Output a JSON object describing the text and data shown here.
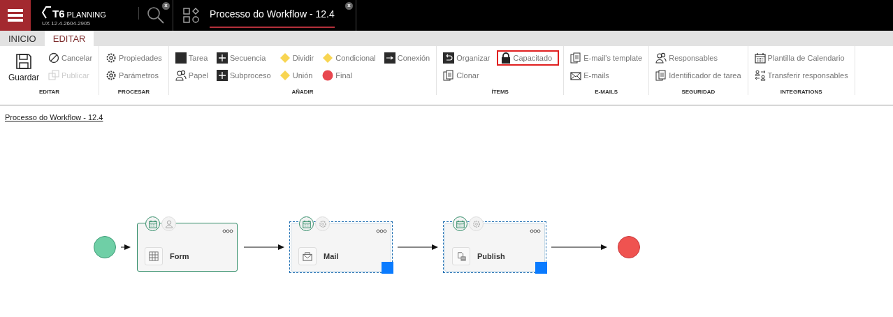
{
  "header": {
    "logo": {
      "mark": "T6",
      "name": "PLANNING",
      "version": "UX 12.4.2604.2905"
    },
    "search_tab": {
      "close": "x"
    },
    "document_tab": {
      "title": "Processo do Workflow - 12.4",
      "close": "x",
      "selected": true
    }
  },
  "tabs": [
    {
      "label": "INICIO",
      "selected": false
    },
    {
      "label": "EDITAR",
      "selected": true
    }
  ],
  "ribbon": [
    {
      "label": "EDITAR",
      "large": {
        "label": "Guardar",
        "kind": "save"
      },
      "rows": [
        [
          {
            "label": "Cancelar",
            "kind": "cancel",
            "disabled": false,
            "highlighted": false
          }
        ],
        [
          {
            "label": "Publicar",
            "kind": "publish",
            "disabled": true,
            "highlighted": false
          }
        ]
      ]
    },
    {
      "label": "PROCESAR",
      "rows": [
        [
          {
            "label": "Propiedades",
            "kind": "gear",
            "disabled": false,
            "highlighted": false
          }
        ],
        [
          {
            "label": "Parámetros",
            "kind": "gear",
            "disabled": false,
            "highlighted": false
          }
        ]
      ]
    },
    {
      "label": "AÑADIR",
      "rows": [
        [
          {
            "label": "Tarea",
            "kind": "square",
            "disabled": false,
            "highlighted": false
          },
          {
            "label": "Secuencia",
            "kind": "plus",
            "disabled": false,
            "highlighted": false
          },
          {
            "label": "Dividir",
            "kind": "diamond",
            "disabled": false,
            "highlighted": false
          },
          {
            "label": "Condicional",
            "kind": "diamond",
            "disabled": false,
            "highlighted": false
          },
          {
            "label": "Conexión",
            "kind": "connector",
            "disabled": false,
            "highlighted": false
          }
        ],
        [
          {
            "label": "Papel",
            "kind": "people",
            "disabled": false,
            "highlighted": false
          },
          {
            "label": "Subproceso",
            "kind": "plus",
            "disabled": false,
            "highlighted": false
          },
          {
            "label": "Unión",
            "kind": "diamond",
            "disabled": false,
            "highlighted": false
          },
          {
            "label": "Final",
            "kind": "circle",
            "disabled": false,
            "highlighted": false
          }
        ]
      ]
    },
    {
      "label": "ÍTEMS",
      "rows": [
        [
          {
            "label": "Organizar",
            "kind": "undo",
            "disabled": false,
            "highlighted": false
          },
          {
            "label": "Capacitado",
            "kind": "lock",
            "disabled": false,
            "highlighted": true
          }
        ],
        [
          {
            "label": "Clonar",
            "kind": "copy",
            "disabled": false,
            "highlighted": false
          }
        ]
      ]
    },
    {
      "label": "E-MAILS",
      "rows": [
        [
          {
            "label": "E-mail's template",
            "kind": "copy",
            "disabled": false,
            "highlighted": false
          }
        ],
        [
          {
            "label": "E-mails",
            "kind": "mail",
            "disabled": false,
            "highlighted": false
          }
        ]
      ]
    },
    {
      "label": "SEGURIDAD",
      "rows": [
        [
          {
            "label": "Responsables",
            "kind": "people",
            "disabled": false,
            "highlighted": false
          }
        ],
        [
          {
            "label": "Identificador de tarea",
            "kind": "copy",
            "disabled": false,
            "highlighted": false
          }
        ]
      ]
    },
    {
      "label": "INTEGRATIONS",
      "rows": [
        [
          {
            "label": "Plantilla de Calendario",
            "kind": "calendar",
            "disabled": false,
            "highlighted": false
          }
        ],
        [
          {
            "label": "Transferir responsables",
            "kind": "transfer",
            "disabled": false,
            "highlighted": false
          }
        ]
      ]
    }
  ],
  "breadcrumb": "Processo do Workflow - 12.4",
  "diagram": {
    "nodes": [
      {
        "label": "Form",
        "kind": "form",
        "selected": false
      },
      {
        "label": "Mail",
        "kind": "mail",
        "selected": true
      },
      {
        "label": "Publish",
        "kind": "publish",
        "selected": true
      }
    ]
  }
}
